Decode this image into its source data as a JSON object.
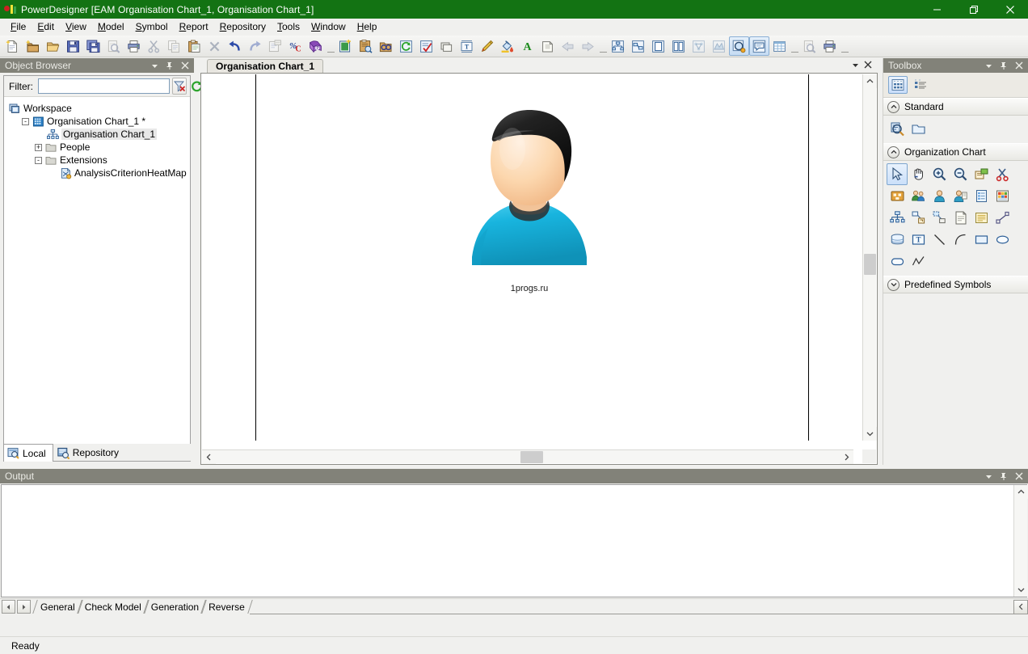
{
  "window": {
    "title": "PowerDesigner [EAM Organisation Chart_1, Organisation Chart_1]",
    "app_icon": "powerdesigner-icon",
    "minimize_label": "Minimize",
    "maximize_label": "Maximize",
    "close_label": "Close",
    "titlebar_color": "#137313"
  },
  "menubar": {
    "items": [
      {
        "label": "File",
        "accel": "F"
      },
      {
        "label": "Edit",
        "accel": "E"
      },
      {
        "label": "View",
        "accel": "V"
      },
      {
        "label": "Model",
        "accel": "M"
      },
      {
        "label": "Symbol",
        "accel": "S"
      },
      {
        "label": "Report",
        "accel": "R"
      },
      {
        "label": "Repository",
        "accel": "R"
      },
      {
        "label": "Tools",
        "accel": "T"
      },
      {
        "label": "Window",
        "accel": "W"
      },
      {
        "label": "Help",
        "accel": "H"
      }
    ]
  },
  "toolbar": {
    "buttons": [
      {
        "name": "new-model-icon",
        "tooltip": "New Model"
      },
      {
        "name": "new-package-icon",
        "tooltip": "New Package"
      },
      {
        "name": "open-model-icon",
        "tooltip": "Open Model"
      },
      {
        "name": "save-icon",
        "tooltip": "Save"
      },
      {
        "name": "save-all-icon",
        "tooltip": "Save All"
      },
      {
        "name": "print-preview-icon",
        "tooltip": "Print Preview",
        "disabled": true
      },
      {
        "name": "print-icon",
        "tooltip": "Print"
      },
      {
        "name": "cut-icon",
        "tooltip": "Cut",
        "disabled": true
      },
      {
        "name": "copy-icon",
        "tooltip": "Copy",
        "disabled": true
      },
      {
        "name": "paste-icon",
        "tooltip": "Paste"
      },
      {
        "name": "delete-icon",
        "tooltip": "Delete",
        "disabled": true
      },
      {
        "name": "undo-icon",
        "tooltip": "Undo"
      },
      {
        "name": "redo-icon",
        "tooltip": "Redo",
        "disabled": true
      },
      {
        "name": "properties-icon",
        "tooltip": "Properties",
        "disabled": true
      },
      {
        "name": "check-model-icon",
        "tooltip": "Check Model"
      },
      {
        "name": "help-icon",
        "tooltip": "Help"
      },
      {
        "name": "separator"
      },
      {
        "name": "new-diagram-icon",
        "tooltip": "New Diagram"
      },
      {
        "name": "list-of-objects-icon",
        "tooltip": "List of Objects"
      },
      {
        "name": "find-objects-icon",
        "tooltip": "Find Objects"
      },
      {
        "name": "refresh-icon",
        "tooltip": "Refresh"
      },
      {
        "name": "check-icon",
        "tooltip": "Check"
      },
      {
        "name": "symbol-icon",
        "tooltip": "Symbol Format"
      },
      {
        "name": "text-frame-icon",
        "tooltip": "Text Frame"
      },
      {
        "name": "pen-icon",
        "tooltip": "Line Style"
      },
      {
        "name": "fill-color-icon",
        "tooltip": "Fill Color"
      },
      {
        "name": "font-color-icon",
        "tooltip": "Font Color"
      },
      {
        "name": "shadow-icon",
        "tooltip": "Shadow"
      },
      {
        "name": "align-left-icon",
        "tooltip": "Align Left",
        "disabled": true
      },
      {
        "name": "align-right-icon",
        "tooltip": "Align Right",
        "disabled": true
      },
      {
        "name": "separator"
      },
      {
        "name": "diagram-view-icon",
        "tooltip": "Diagram"
      },
      {
        "name": "model-view-icon",
        "tooltip": "Model View"
      },
      {
        "name": "page-view-icon",
        "tooltip": "Page View"
      },
      {
        "name": "columns-view-icon",
        "tooltip": "Columns View"
      },
      {
        "name": "dependency-icon",
        "tooltip": "Dependency Matrix",
        "disabled": true
      },
      {
        "name": "map-icon",
        "tooltip": "Map View",
        "disabled": true
      },
      {
        "name": "zoom-window-icon",
        "tooltip": "Zoom",
        "active": true
      },
      {
        "name": "comment-icon",
        "tooltip": "Comment",
        "active": true
      },
      {
        "name": "grid-icon",
        "tooltip": "Grid"
      },
      {
        "name": "separator"
      },
      {
        "name": "preview-icon",
        "tooltip": "Preview",
        "disabled": true
      },
      {
        "name": "print-setup-icon",
        "tooltip": "Print Setup"
      },
      {
        "name": "separator"
      }
    ]
  },
  "browser": {
    "title": "Object Browser",
    "menu_button": "panel-menu-icon",
    "pin_button": "pin-icon",
    "close_button": "close-icon",
    "filter": {
      "label": "Filter:",
      "value": "",
      "placeholder": "",
      "clear_button": "clear-filter-icon",
      "refresh_button": "refresh-icon"
    },
    "tree": [
      {
        "label": "Workspace",
        "icon": "workspace-icon",
        "depth": 0,
        "expander": "",
        "selected": false
      },
      {
        "label": "Organisation Chart_1 *",
        "icon": "model-icon",
        "depth": 1,
        "expander": "-",
        "selected": false
      },
      {
        "label": "Organisation Chart_1",
        "icon": "orgchart-icon",
        "depth": 2,
        "expander": "",
        "selected": true
      },
      {
        "label": "People",
        "icon": "folder-icon",
        "depth": 2,
        "expander": "+",
        "selected": false
      },
      {
        "label": "Extensions",
        "icon": "folder-icon",
        "depth": 2,
        "expander": "-",
        "selected": false
      },
      {
        "label": "AnalysisCriterionHeatMap",
        "icon": "extension-icon",
        "depth": 3,
        "expander": "",
        "selected": false
      }
    ],
    "tabs": [
      {
        "label": "Local",
        "icon": "local-icon",
        "active": true
      },
      {
        "label": "Repository",
        "icon": "repository-icon",
        "active": false
      }
    ]
  },
  "document": {
    "tab_label": "Organisation Chart_1",
    "tab_menu_button": "tab-dropdown-icon",
    "tab_close_button": "close-icon",
    "diagram": {
      "symbol": {
        "name": "person-avatar",
        "caption": "1progs.ru",
        "hair_color": "#1e1e1e",
        "skin_color": "#f6cfa8",
        "shirt_color": "#19aedb"
      },
      "page_breaks": [
        66,
        750
      ]
    },
    "scroll": {
      "vertical_thumb_pct": 50,
      "horizontal_thumb_pct": 50,
      "up_arrow": "chevron-up-icon",
      "down_arrow": "chevron-down-icon",
      "left_arrow": "chevron-left-icon",
      "right_arrow": "chevron-right-icon"
    }
  },
  "toolbox": {
    "title": "Toolbox",
    "menu_button": "panel-menu-icon",
    "pin_button": "pin-icon",
    "close_button": "close-icon",
    "view_modes": [
      {
        "name": "grid-view-icon",
        "selected": true
      },
      {
        "name": "list-view-icon",
        "selected": false
      }
    ],
    "sections": [
      {
        "label": "Standard",
        "collapse_icon": "chevron-up-icon",
        "expanded": true,
        "tools": [
          {
            "name": "zoom-properties-icon",
            "tooltip": "Properties"
          },
          {
            "name": "package-icon",
            "tooltip": "Package"
          }
        ]
      },
      {
        "label": "Organization Chart",
        "collapse_icon": "chevron-up-icon",
        "expanded": true,
        "tools": [
          {
            "name": "pointer-icon",
            "tooltip": "Pointer",
            "selected": true
          },
          {
            "name": "grabber-hand-icon",
            "tooltip": "Grabber"
          },
          {
            "name": "zoom-in-icon",
            "tooltip": "Zoom In"
          },
          {
            "name": "zoom-out-icon",
            "tooltip": "Zoom Out"
          },
          {
            "name": "open-package-icon",
            "tooltip": "Open Package"
          },
          {
            "name": "delete-scissors-icon",
            "tooltip": "Delete"
          },
          {
            "name": "organization-unit-icon",
            "tooltip": "Organization Unit"
          },
          {
            "name": "group-icon",
            "tooltip": "Group"
          },
          {
            "name": "person-icon",
            "tooltip": "Person"
          },
          {
            "name": "person-role-icon",
            "tooltip": "Role"
          },
          {
            "name": "document-blue-icon",
            "tooltip": "Document"
          },
          {
            "name": "heatmap-icon",
            "tooltip": "Heat Map"
          },
          {
            "name": "org-structure-icon",
            "tooltip": "Organization Structure"
          },
          {
            "name": "link-object-icon",
            "tooltip": "Link"
          },
          {
            "name": "dependency-link-icon",
            "tooltip": "Dependency"
          },
          {
            "name": "note-icon",
            "tooltip": "Note"
          },
          {
            "name": "text-document-icon",
            "tooltip": "Text"
          },
          {
            "name": "link-arrow-icon",
            "tooltip": "Link Arrow"
          },
          {
            "name": "file-stack-icon",
            "tooltip": "File"
          },
          {
            "name": "title-box-icon",
            "tooltip": "Title"
          },
          {
            "name": "line-icon",
            "tooltip": "Line"
          },
          {
            "name": "arc-icon",
            "tooltip": "Arc"
          },
          {
            "name": "rectangle-icon",
            "tooltip": "Rectangle"
          },
          {
            "name": "ellipse-icon",
            "tooltip": "Ellipse"
          },
          {
            "name": "rounded-rect-icon",
            "tooltip": "Rounded Rectangle"
          },
          {
            "name": "polyline-icon",
            "tooltip": "Polyline"
          }
        ]
      },
      {
        "label": "Predefined Symbols",
        "collapse_icon": "chevron-down-icon",
        "expanded": false,
        "tools": []
      }
    ]
  },
  "output": {
    "title": "Output",
    "menu_button": "panel-menu-icon",
    "pin_button": "pin-icon",
    "close_button": "close-icon",
    "content": "",
    "tabs": [
      {
        "label": "General",
        "active": true
      },
      {
        "label": "Check Model",
        "active": false
      },
      {
        "label": "Generation",
        "active": false
      },
      {
        "label": "Reverse",
        "active": false
      }
    ],
    "nav_prev": "prev-icon",
    "nav_next": "next-icon",
    "scroll_left": "chevron-left-icon"
  },
  "statusbar": {
    "message": "Ready"
  }
}
